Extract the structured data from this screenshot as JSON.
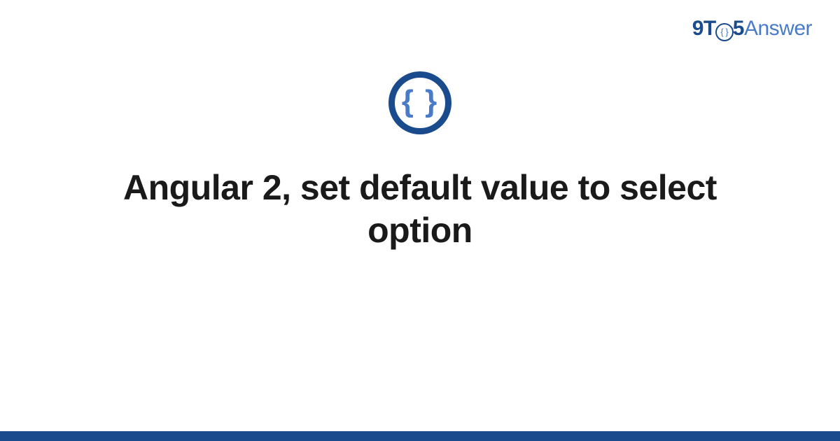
{
  "brand": {
    "part1": "9T",
    "clock_inner": "{ }",
    "part2": "5",
    "part3": "Answer"
  },
  "icon": {
    "name": "code-braces-icon",
    "glyph": "{ }"
  },
  "title": "Angular 2, set default value to select option",
  "colors": {
    "primary": "#1a4b8c",
    "secondary": "#4a7bc8"
  }
}
